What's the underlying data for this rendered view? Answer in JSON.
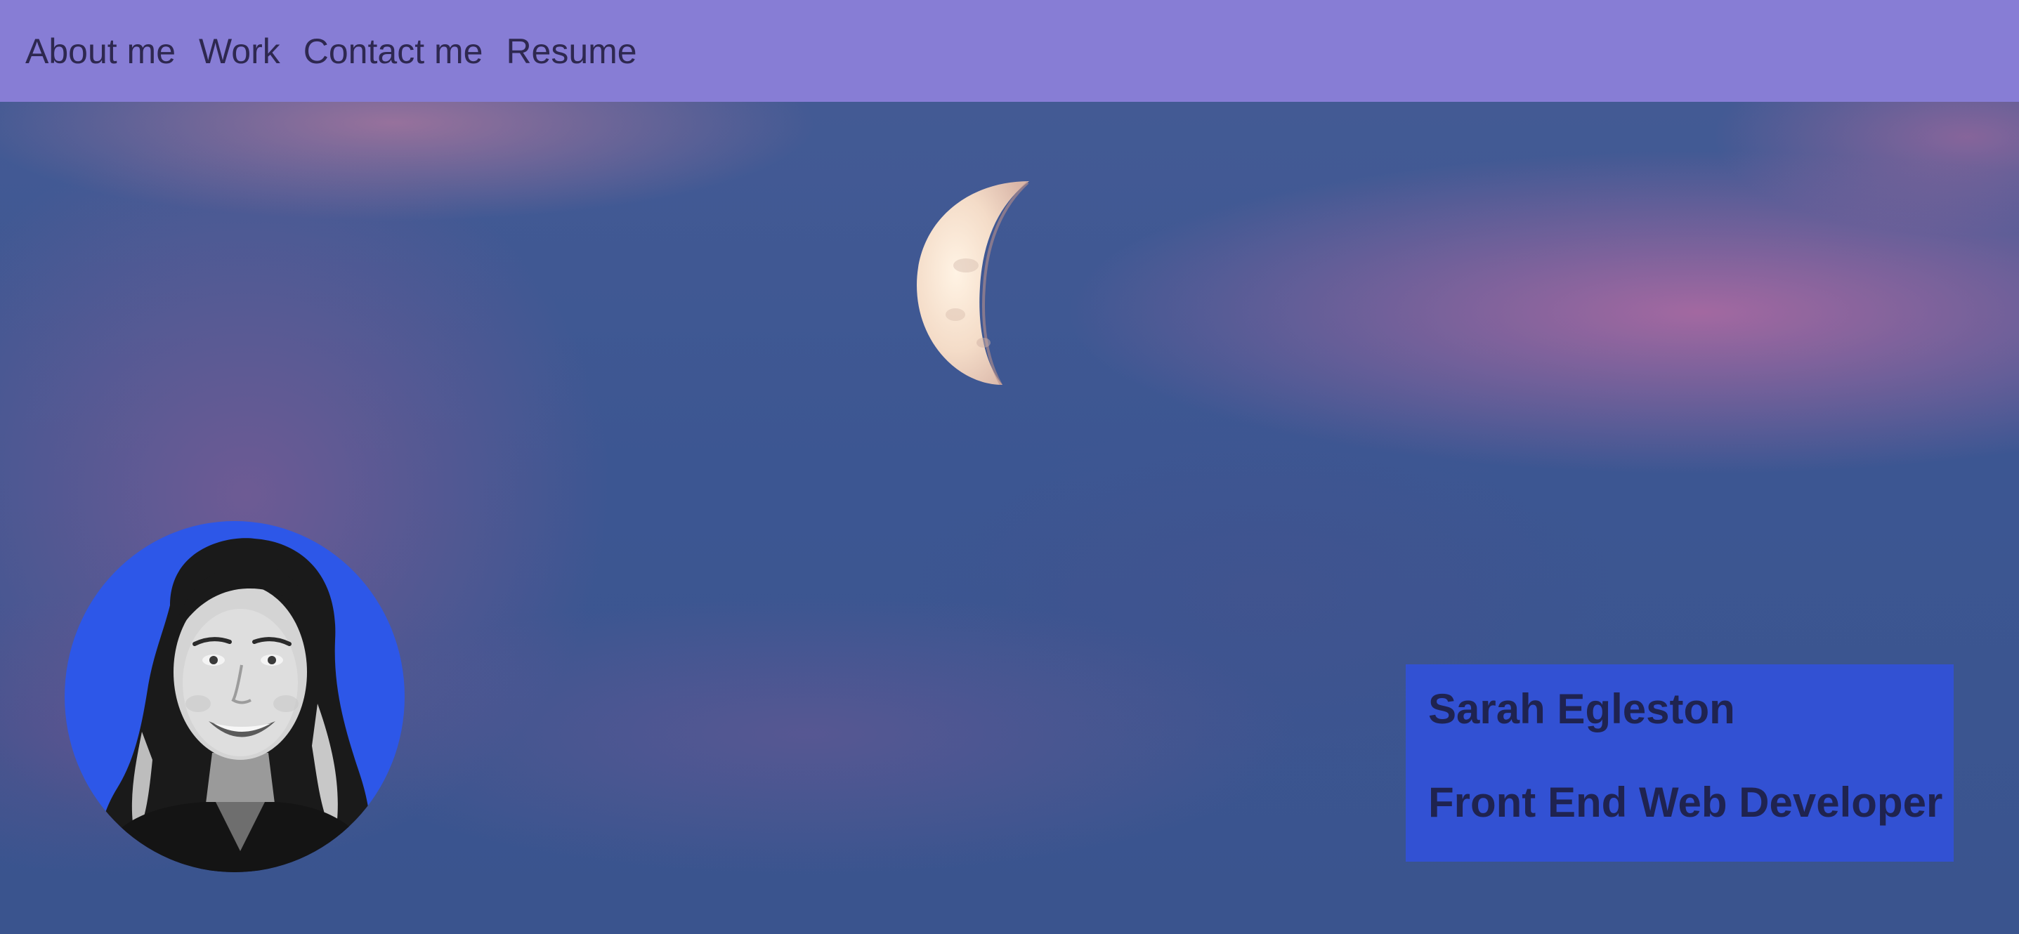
{
  "nav": {
    "items": [
      {
        "label": "About me"
      },
      {
        "label": "Work"
      },
      {
        "label": "Contact me"
      },
      {
        "label": "Resume"
      }
    ]
  },
  "hero": {
    "name": "Sarah Egleston",
    "title": "Front End Web Developer"
  },
  "colors": {
    "nav_background": "#877dd5",
    "nav_text": "#2e2850",
    "sky": "#3b5591",
    "card_background": "#3251d3",
    "avatar_background": "#2d57e8",
    "card_text": "#1f2350"
  }
}
